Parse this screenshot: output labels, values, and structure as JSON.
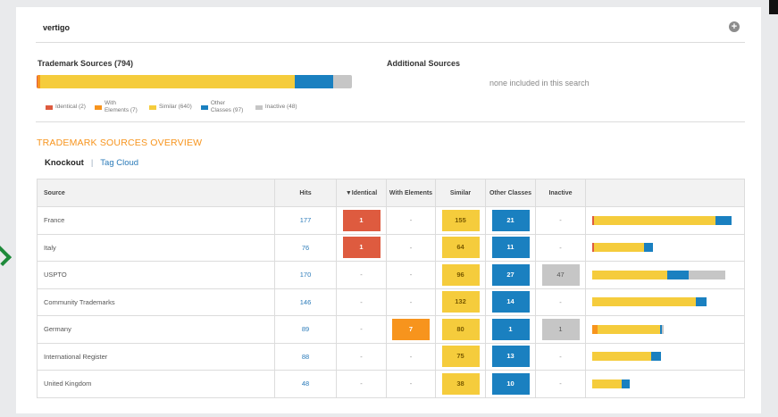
{
  "query": "vertigo",
  "add_icon": "plus-icon",
  "colors": {
    "identical": "#de5b3f",
    "with_elements": "#f7941d",
    "similar": "#f5cc3c",
    "other_classes": "#1a80c0",
    "inactive": "#c6c6c6",
    "accent": "#f7941d",
    "link": "#2b7bb9"
  },
  "trademark_sources": {
    "title": "Trademark Sources (794)",
    "summary_bar": {
      "identical": 2,
      "with_elements": 7,
      "similar": 640,
      "other_classes": 97,
      "inactive": 48,
      "total": 794
    },
    "legend": [
      {
        "key": "identical",
        "label": "Identical (2)"
      },
      {
        "key": "with_elements",
        "label": "With Elements (7)"
      },
      {
        "key": "similar",
        "label": "Similar (640)"
      },
      {
        "key": "other_classes",
        "label": "Other Classes (97)"
      },
      {
        "key": "inactive",
        "label": "Inactive (48)"
      }
    ]
  },
  "additional_sources": {
    "title": "Additional Sources",
    "note": "none included in this search"
  },
  "overview": {
    "title": "TRADEMARK SOURCES OVERVIEW",
    "tabs": {
      "knockout": "Knockout",
      "separator": "|",
      "tag_cloud": "Tag Cloud"
    }
  },
  "table": {
    "headers": {
      "source": "Source",
      "hits": "Hits",
      "identical": "▼Identical",
      "with_elements": "With Elements",
      "similar": "Similar",
      "other_classes": "Other Classes",
      "inactive": "Inactive"
    },
    "rows": [
      {
        "source": "France",
        "hits": 177,
        "identical": 1,
        "with_elements": null,
        "similar": 155,
        "other_classes": 21,
        "inactive": null
      },
      {
        "source": "Italy",
        "hits": 76,
        "identical": 1,
        "with_elements": null,
        "similar": 64,
        "other_classes": 11,
        "inactive": null
      },
      {
        "source": "USPTO",
        "hits": 170,
        "identical": null,
        "with_elements": null,
        "similar": 96,
        "other_classes": 27,
        "inactive": 47
      },
      {
        "source": "Community Trademarks",
        "hits": 146,
        "identical": null,
        "with_elements": null,
        "similar": 132,
        "other_classes": 14,
        "inactive": null
      },
      {
        "source": "Germany",
        "hits": 89,
        "identical": null,
        "with_elements": 7,
        "similar": 80,
        "other_classes": 1,
        "inactive": 1
      },
      {
        "source": "International Register",
        "hits": 88,
        "identical": null,
        "with_elements": null,
        "similar": 75,
        "other_classes": 13,
        "inactive": null
      },
      {
        "source": "United Kingdom",
        "hits": 48,
        "identical": null,
        "with_elements": null,
        "similar": 38,
        "other_classes": 10,
        "inactive": null
      }
    ],
    "empty_value": "-"
  }
}
